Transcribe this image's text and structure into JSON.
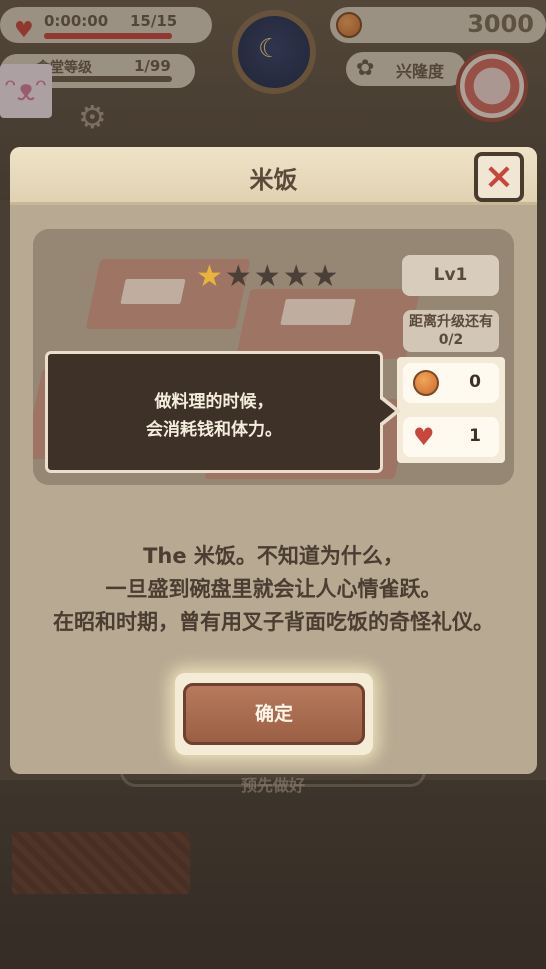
{
  "hud": {
    "timer": "0:00:00",
    "stamina": "15/15",
    "level_label": "食堂等级",
    "level_value": "1/99",
    "money": "3000",
    "popularity_label": "兴隆度"
  },
  "dialog": {
    "title": "米饭",
    "close_icon": "×",
    "rating": {
      "filled": 1,
      "total": 5
    },
    "level_badge": "Lv1",
    "upgrade_label": "距离升级还有",
    "upgrade_value": "0/2",
    "costs": [
      {
        "icon": "coin-icon",
        "value": "0"
      },
      {
        "icon": "heart-icon",
        "value": "1"
      }
    ],
    "tooltip_line1": "做料理的时候，",
    "tooltip_line2": "会消耗钱和体力。",
    "desc_line1": "The 米饭。不知道为什么，",
    "desc_line2": "一旦盛到碗盘里就会让人心情雀跃。",
    "desc_line3": "在昭和时期，曾有用叉子背面吃饭的奇怪礼仪。",
    "confirm_label": "确定"
  },
  "background": {
    "ghost_button_label": "预先做好"
  },
  "colors": {
    "accent_red": "#c9463c",
    "button_brown": "#9b5f45",
    "star_gold": "#e8b43a"
  }
}
